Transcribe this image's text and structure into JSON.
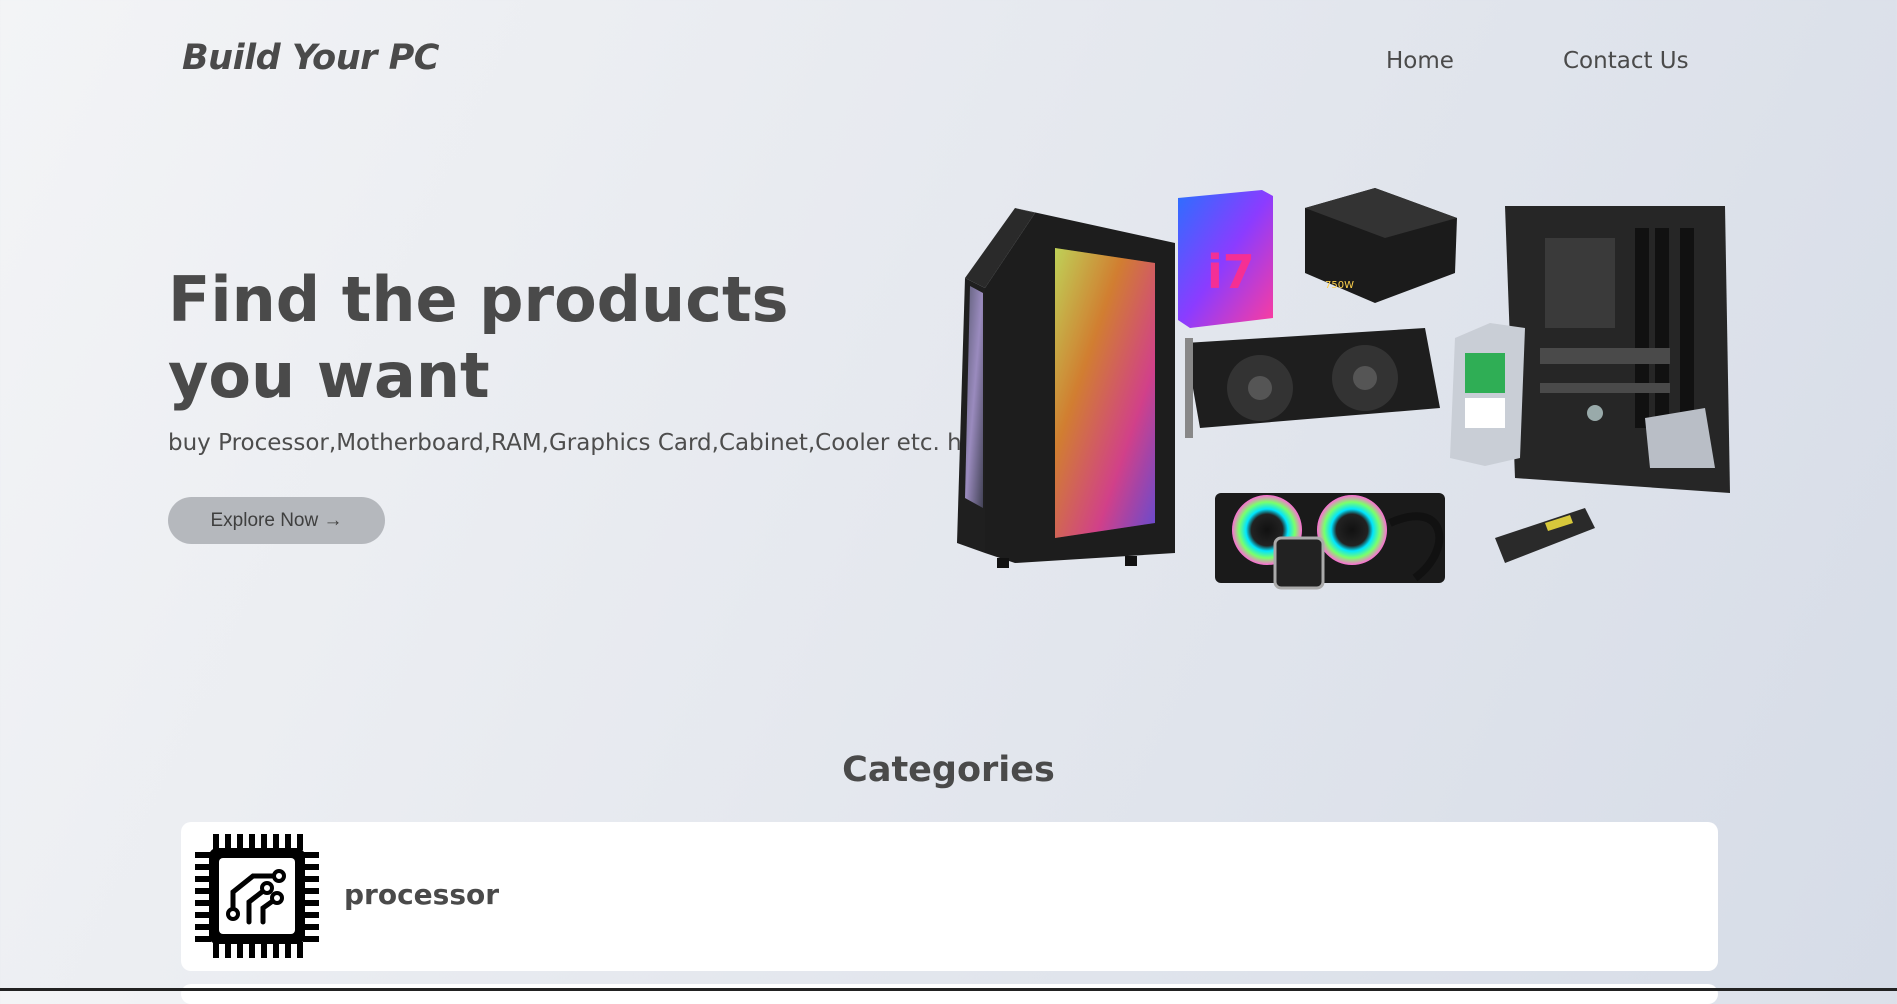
{
  "header": {
    "brand": "Build Your PC",
    "nav": {
      "home": "Home",
      "contact": "Contact Us"
    }
  },
  "hero": {
    "title": "Find the products you want",
    "subtitle": "buy Processor,Motherboard,RAM,Graphics Card,Cabinet,Cooler etc. here",
    "cta": "Explore Now →",
    "image_alt": "pc-components-collage"
  },
  "categories": {
    "heading": "Categories",
    "items": [
      {
        "label": "processor",
        "icon": "processor-chip-icon"
      }
    ]
  },
  "colors": {
    "text": "#4a4a4a",
    "button_bg": "#b5b8bd",
    "card_bg": "#ffffff"
  }
}
